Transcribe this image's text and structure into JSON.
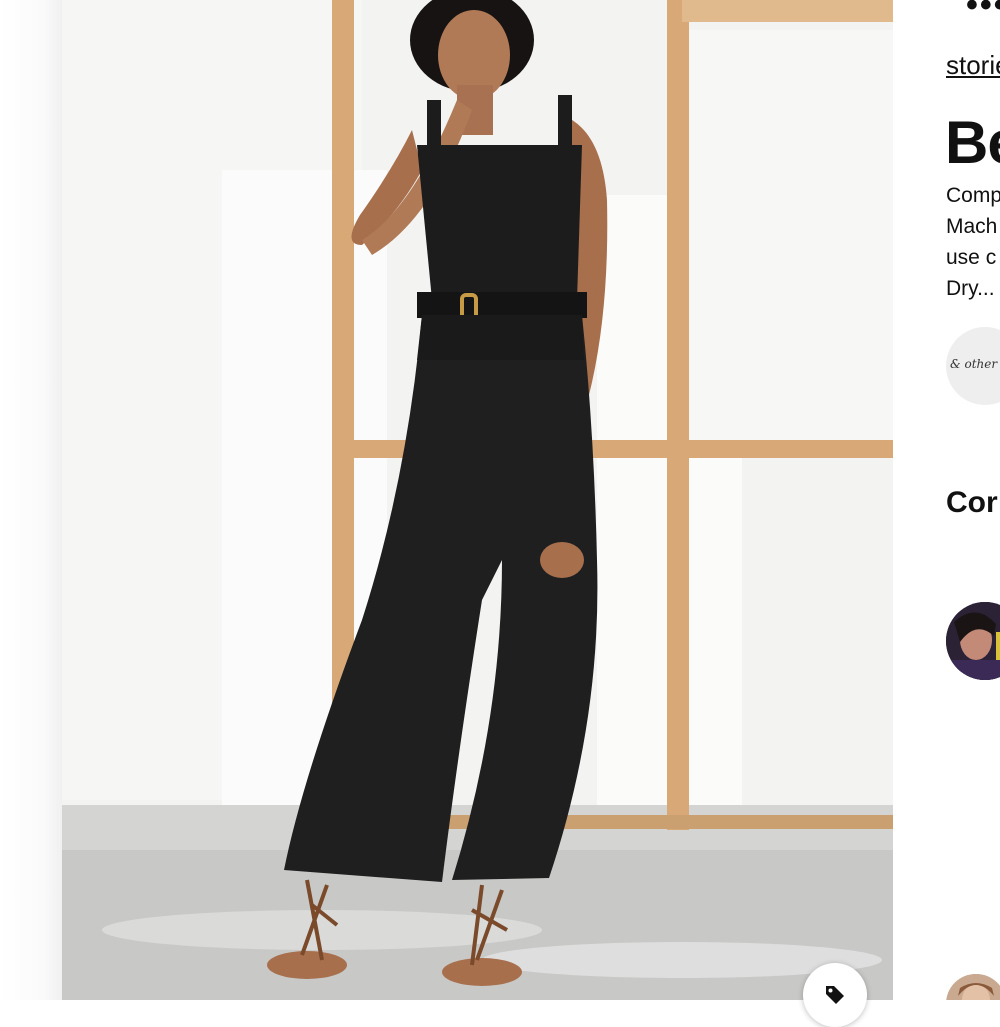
{
  "pin": {
    "image_alt": "Woman wearing a black belted cropped jumpsuit with lace-up sandals",
    "source_label": "storie",
    "title": "Be",
    "description_lines": [
      "Comp",
      "Mach",
      "use c",
      "Dry..."
    ],
    "brand_avatar_text": "& other St"
  },
  "comments": {
    "heading": "Cor"
  },
  "icons": {
    "more": "more-horizontal-icon",
    "tag": "tag-icon"
  },
  "colors": {
    "text": "#111111",
    "jumpsuit": "#1a1a1a",
    "wood_frame": "#d8a877",
    "wall": "#f3f3f1",
    "floor": "#cfcfcf"
  }
}
